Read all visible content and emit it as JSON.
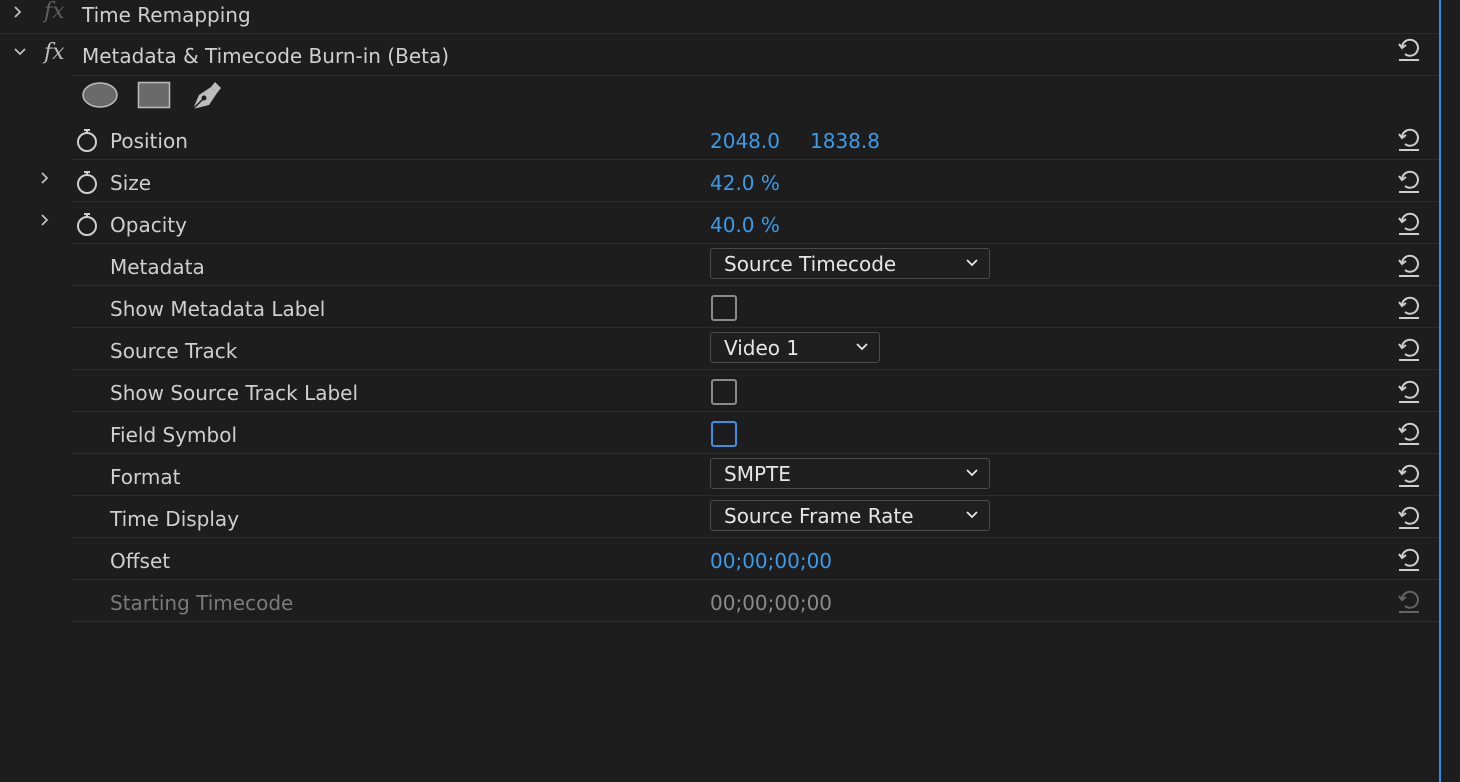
{
  "effects": {
    "time_remapping": {
      "label": "Time Remapping"
    },
    "burnin": {
      "label": "Metadata & Timecode Burn-in (Beta)",
      "mask_tools": [
        "ellipse-mask-icon",
        "rectangle-mask-icon",
        "pen-mask-icon"
      ],
      "params": {
        "position": {
          "label": "Position",
          "x": "2048.0",
          "y": "1838.8"
        },
        "size": {
          "label": "Size",
          "value": "42.0 %"
        },
        "opacity": {
          "label": "Opacity",
          "value": "40.0 %"
        },
        "metadata": {
          "label": "Metadata",
          "value": "Source Timecode"
        },
        "show_metadata_label": {
          "label": "Show Metadata Label",
          "checked": false
        },
        "source_track": {
          "label": "Source Track",
          "value": "Video 1"
        },
        "show_source_track_label": {
          "label": "Show Source Track Label",
          "checked": false
        },
        "field_symbol": {
          "label": "Field Symbol",
          "checked": false
        },
        "format": {
          "label": "Format",
          "value": "SMPTE"
        },
        "time_display": {
          "label": "Time Display",
          "value": "Source Frame Rate"
        },
        "offset": {
          "label": "Offset",
          "value": "00;00;00;00"
        },
        "starting_timecode": {
          "label": "Starting Timecode",
          "value": "00;00;00;00"
        }
      }
    }
  },
  "colors": {
    "background": "#1d1d1d",
    "value_blue": "#3b9be8",
    "text": "#cfcfcf",
    "panel_edge": "#2d8ceb"
  }
}
